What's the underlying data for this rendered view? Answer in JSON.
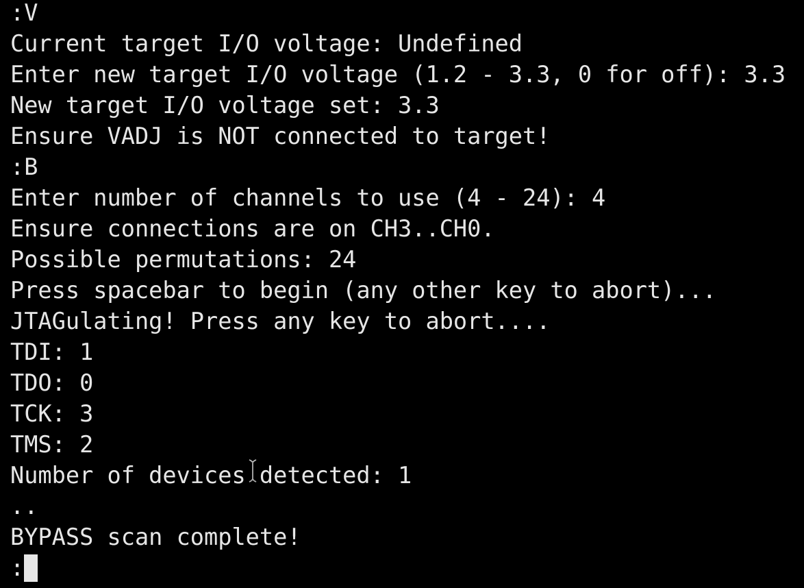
{
  "terminal": {
    "lines": [
      ":V",
      "Current target I/O voltage: Undefined",
      "Enter new target I/O voltage (1.2 - 3.3, 0 for off): 3.3",
      "New target I/O voltage set: 3.3",
      "Ensure VADJ is NOT connected to target!",
      ":B",
      "Enter number of channels to use (4 - 24): 4",
      "Ensure connections are on CH3..CH0.",
      "Possible permutations: 24",
      "Press spacebar to begin (any other key to abort)...",
      "JTAGulating! Press any key to abort....",
      "TDI: 1",
      "TDO: 0",
      "TCK: 3",
      "TMS: 2",
      "Number of devices detected: 1",
      "..",
      "BYPASS scan complete!"
    ],
    "prompt": ":",
    "cursor_icon": "block-cursor-icon",
    "mouse_icon": "ibeam-cursor-icon",
    "colors": {
      "background": "#000000",
      "foreground": "#e6e6e6"
    }
  }
}
